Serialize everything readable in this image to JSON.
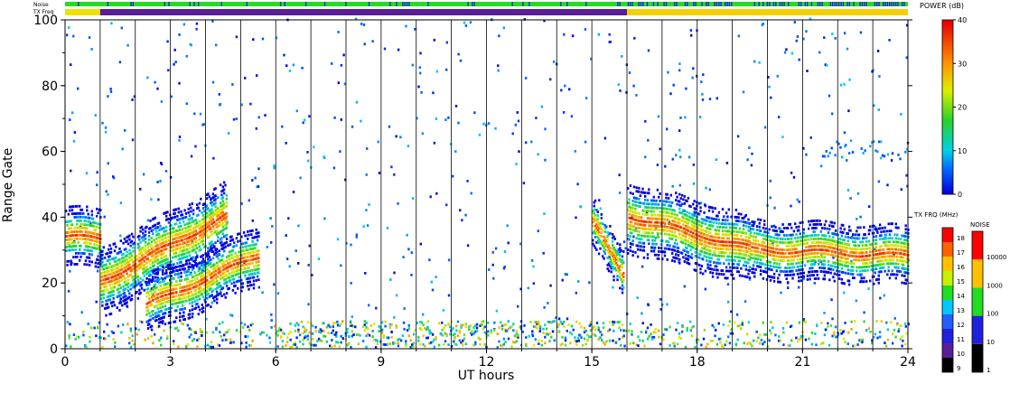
{
  "chart_data": {
    "type": "heatmap",
    "xlabel": "UT hours",
    "ylabel": "Range Gate",
    "xlim": [
      0,
      24
    ],
    "ylim": [
      0,
      100
    ],
    "xticks": [
      0,
      3,
      6,
      9,
      12,
      15,
      18,
      21,
      24
    ],
    "yticks": [
      0,
      20,
      40,
      60,
      80,
      100
    ],
    "grid_x_hours": [
      1,
      2,
      3,
      4,
      5,
      6,
      7,
      8,
      9,
      10,
      11,
      12,
      13,
      14,
      15,
      16,
      17,
      18,
      19,
      20,
      21,
      22,
      23,
      24
    ],
    "status_bars": {
      "noise_label": "Noise",
      "txfreq_label": "TX Freq",
      "noise_color": "#22dd22",
      "noise_alt_color": "#2222dd",
      "txfreq_segments": [
        {
          "start": 0,
          "end": 1,
          "color": "#f0e000"
        },
        {
          "start": 1,
          "end": 16,
          "color": "#5a1e96"
        },
        {
          "start": 16,
          "end": 24,
          "color": "#f5d000"
        }
      ]
    },
    "power_colorbar": {
      "title": "POWER (dB)",
      "ticks": [
        0,
        10,
        20,
        30,
        40
      ],
      "range": [
        0,
        40
      ]
    },
    "txfreq_colorbar": {
      "title": "TX FRQ (MHz)",
      "labels": [
        "9",
        "10",
        "11",
        "12",
        "13",
        "14",
        "15",
        "16",
        "17",
        "18"
      ],
      "colors": [
        "#000000",
        "#5a1e96",
        "#2020dd",
        "#2060ff",
        "#00c8ff",
        "#20dd20",
        "#c8f000",
        "#ffc000",
        "#ff6000",
        "#ff0000"
      ]
    },
    "noise_colorbar": {
      "title": "NOISE",
      "labels": [
        "1",
        "10",
        "100",
        "1000",
        "10000"
      ],
      "colors": [
        "#000000",
        "#2020dd",
        "#20dd20",
        "#ffc000",
        "#ff0000"
      ]
    },
    "scatter_bands": [
      {
        "name": "band-a",
        "t0": 0.0,
        "t1": 1.0,
        "g0": 34,
        "g1": 33,
        "width": 5
      },
      {
        "name": "band-b",
        "t0": 1.0,
        "t1": 4.6,
        "g0": 20,
        "g1": 40,
        "width": 6
      },
      {
        "name": "band-c",
        "t0": 2.3,
        "t1": 5.5,
        "g0": 13,
        "g1": 28,
        "width": 5
      },
      {
        "name": "band-d",
        "t0": 15.0,
        "t1": 15.9,
        "g0": 38,
        "g1": 22,
        "width": 4
      },
      {
        "name": "band-e",
        "t0": 16.0,
        "t1": 19.5,
        "g0": 40,
        "g1": 30,
        "width": 6
      },
      {
        "name": "band-f",
        "t0": 19.5,
        "t1": 24.0,
        "g0": 30,
        "g1": 28,
        "width": 5
      }
    ]
  }
}
